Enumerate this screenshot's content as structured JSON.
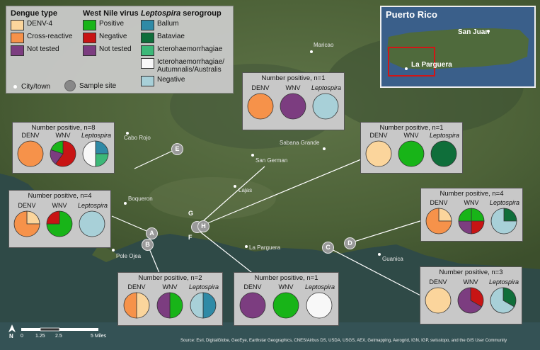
{
  "legend": {
    "dengue": {
      "title": "Dengue type",
      "items": [
        {
          "label": "DENV-4",
          "color": "#fbd59c"
        },
        {
          "label": "Cross-reactive",
          "color": "#f6924a"
        },
        {
          "label": "Not tested",
          "color": "#7c3d80"
        }
      ]
    },
    "wnv": {
      "title": "West Nile virus",
      "items": [
        {
          "label": "Positive",
          "color": "#18b418"
        },
        {
          "label": "Negative",
          "color": "#c81414"
        },
        {
          "label": "Not tested",
          "color": "#7c3d80"
        }
      ]
    },
    "lepto": {
      "title": "serogroup",
      "title_italic": "Leptospira",
      "items": [
        {
          "label": "Ballum",
          "color": "#2f8aa6"
        },
        {
          "label": "Bataviae",
          "color": "#0f6e3a"
        },
        {
          "label": "Icterohaemorrhagiae",
          "color": "#3cb878"
        },
        {
          "label": "Icterohaemorrhagiae/ Autumnalis/Australis",
          "color": "#f8f8f8"
        },
        {
          "label": "Negative",
          "color": "#a8d0d8"
        }
      ]
    },
    "city_label": "City/town",
    "site_label": "Sample site"
  },
  "inset": {
    "title": "Puerto Rico",
    "san_juan": "San Juan",
    "la_parguera": "La Parguera"
  },
  "cities": [
    {
      "name": "Maricao"
    },
    {
      "name": "Cabo Rojo"
    },
    {
      "name": "Sabana Grande"
    },
    {
      "name": "San German"
    },
    {
      "name": "Lajas"
    },
    {
      "name": "Boqueron"
    },
    {
      "name": "Pole Ojea"
    },
    {
      "name": "La Parguera"
    },
    {
      "name": "Guanica"
    }
  ],
  "sites": [
    "A",
    "B",
    "C",
    "D",
    "E",
    "F",
    "G",
    "H"
  ],
  "chart_labels": {
    "denv": "DENV",
    "wnv": "WNV",
    "lepto": "Leptospira"
  },
  "panels": [
    {
      "site": "E",
      "title": "Number positive, n=8",
      "denv": [
        {
          "v": 1,
          "c": "#f6924a"
        }
      ],
      "wnv": [
        {
          "v": 3,
          "c": "#c81414"
        },
        {
          "v": 1,
          "c": "#7c3d80"
        },
        {
          "v": 1,
          "c": "#18b418"
        }
      ],
      "lepto": [
        {
          "v": 1,
          "c": "#2f8aa6"
        },
        {
          "v": 1,
          "c": "#3cb878"
        },
        {
          "v": 2,
          "c": "#f8f8f8"
        }
      ]
    },
    {
      "site": "A",
      "title": "Number positive, n=4",
      "denv": [
        {
          "v": 1,
          "c": "#fbd59c"
        },
        {
          "v": 3,
          "c": "#f6924a"
        }
      ],
      "wnv": [
        {
          "v": 3,
          "c": "#18b418"
        },
        {
          "v": 1,
          "c": "#c81414"
        }
      ],
      "lepto": [
        {
          "v": 1,
          "c": "#a8d0d8"
        }
      ]
    },
    {
      "site": "G",
      "title": "Number positive, n=1",
      "denv": [
        {
          "v": 1,
          "c": "#f6924a"
        }
      ],
      "wnv": [
        {
          "v": 1,
          "c": "#7c3d80"
        }
      ],
      "lepto": [
        {
          "v": 1,
          "c": "#a8d0d8"
        }
      ]
    },
    {
      "site": "H",
      "title": "Number positive, n=1",
      "denv": [
        {
          "v": 1,
          "c": "#fbd59c"
        }
      ],
      "wnv": [
        {
          "v": 1,
          "c": "#18b418"
        }
      ],
      "lepto": [
        {
          "v": 1,
          "c": "#0f6e3a"
        }
      ]
    },
    {
      "site": "D",
      "title": "Number positive, n=4",
      "denv": [
        {
          "v": 1,
          "c": "#fbd59c"
        },
        {
          "v": 3,
          "c": "#f6924a"
        }
      ],
      "wnv": [
        {
          "v": 1,
          "c": "#18b418"
        },
        {
          "v": 1,
          "c": "#c81414"
        },
        {
          "v": 1,
          "c": "#7c3d80"
        },
        {
          "v": 1,
          "c": "#18b418"
        }
      ],
      "lepto": [
        {
          "v": 1,
          "c": "#0f6e3a"
        },
        {
          "v": 3,
          "c": "#a8d0d8"
        }
      ]
    },
    {
      "site": "B",
      "title": "Number positive, n=2",
      "denv": [
        {
          "v": 1,
          "c": "#fbd59c"
        },
        {
          "v": 1,
          "c": "#f6924a"
        }
      ],
      "wnv": [
        {
          "v": 1,
          "c": "#18b418"
        },
        {
          "v": 1,
          "c": "#7c3d80"
        }
      ],
      "lepto": [
        {
          "v": 1,
          "c": "#2f8aa6"
        },
        {
          "v": 1,
          "c": "#a8d0d8"
        }
      ]
    },
    {
      "site": "F",
      "title": "Number positive, n=1",
      "denv": [
        {
          "v": 1,
          "c": "#7c3d80"
        }
      ],
      "wnv": [
        {
          "v": 1,
          "c": "#18b418"
        }
      ],
      "lepto": [
        {
          "v": 1,
          "c": "#f8f8f8"
        }
      ]
    },
    {
      "site": "C",
      "title": "Number positive, n=3",
      "denv": [
        {
          "v": 1,
          "c": "#fbd59c"
        }
      ],
      "wnv": [
        {
          "v": 1,
          "c": "#c81414"
        },
        {
          "v": 2,
          "c": "#7c3d80"
        }
      ],
      "lepto": [
        {
          "v": 1,
          "c": "#0f6e3a"
        },
        {
          "v": 2,
          "c": "#a8d0d8"
        }
      ]
    }
  ],
  "scale": {
    "ticks": [
      "0",
      "1.25",
      "2.5",
      "5 Miles"
    ]
  },
  "north": "N",
  "attribution": "Source: Esri, DigitalGlobe, GeoEye, Earthstar Geographics, CNES/Airbus DS, USDA, USGS, AEX, Getmapping, Aerogrid, IGN, IGP, swisstopo, and the GIS User Community"
}
